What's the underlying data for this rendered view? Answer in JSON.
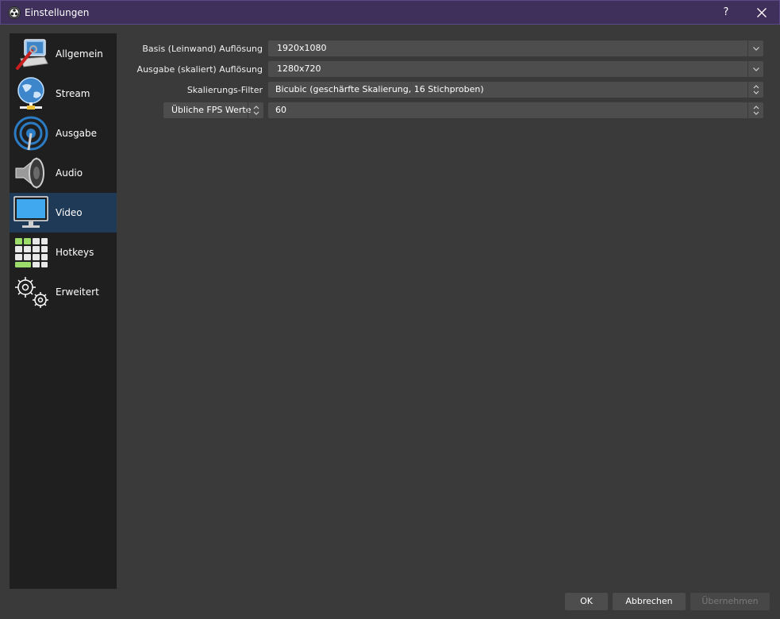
{
  "window": {
    "title": "Einstellungen",
    "help_label": "?",
    "colors": {
      "titlebar": "#3e2f5b",
      "background": "#3a3a3a",
      "sidebar": "#1f1f1f",
      "active": "#1f3a57"
    }
  },
  "sidebar": {
    "items": [
      {
        "label": "Allgemein",
        "icon": "general-settings-icon"
      },
      {
        "label": "Stream",
        "icon": "stream-globe-icon"
      },
      {
        "label": "Ausgabe",
        "icon": "output-broadcast-icon"
      },
      {
        "label": "Audio",
        "icon": "speaker-icon"
      },
      {
        "label": "Video",
        "icon": "monitor-icon",
        "active": true
      },
      {
        "label": "Hotkeys",
        "icon": "keyboard-icon"
      },
      {
        "label": "Erweitert",
        "icon": "gears-icon"
      }
    ]
  },
  "video": {
    "base_resolution": {
      "label": "Basis (Leinwand) Auflösung",
      "value": "1920x1080"
    },
    "output_resolution": {
      "label": "Ausgabe (skaliert) Auflösung",
      "value": "1280x720"
    },
    "scale_filter": {
      "label": "Skalierungs-Filter",
      "value": "Bicubic (geschärfte Skalierung, 16 Stichproben)"
    },
    "fps": {
      "type_value": "Übliche FPS Werte",
      "value": "60"
    }
  },
  "buttons": {
    "ok": "OK",
    "cancel": "Abbrechen",
    "apply": "Übernehmen"
  }
}
